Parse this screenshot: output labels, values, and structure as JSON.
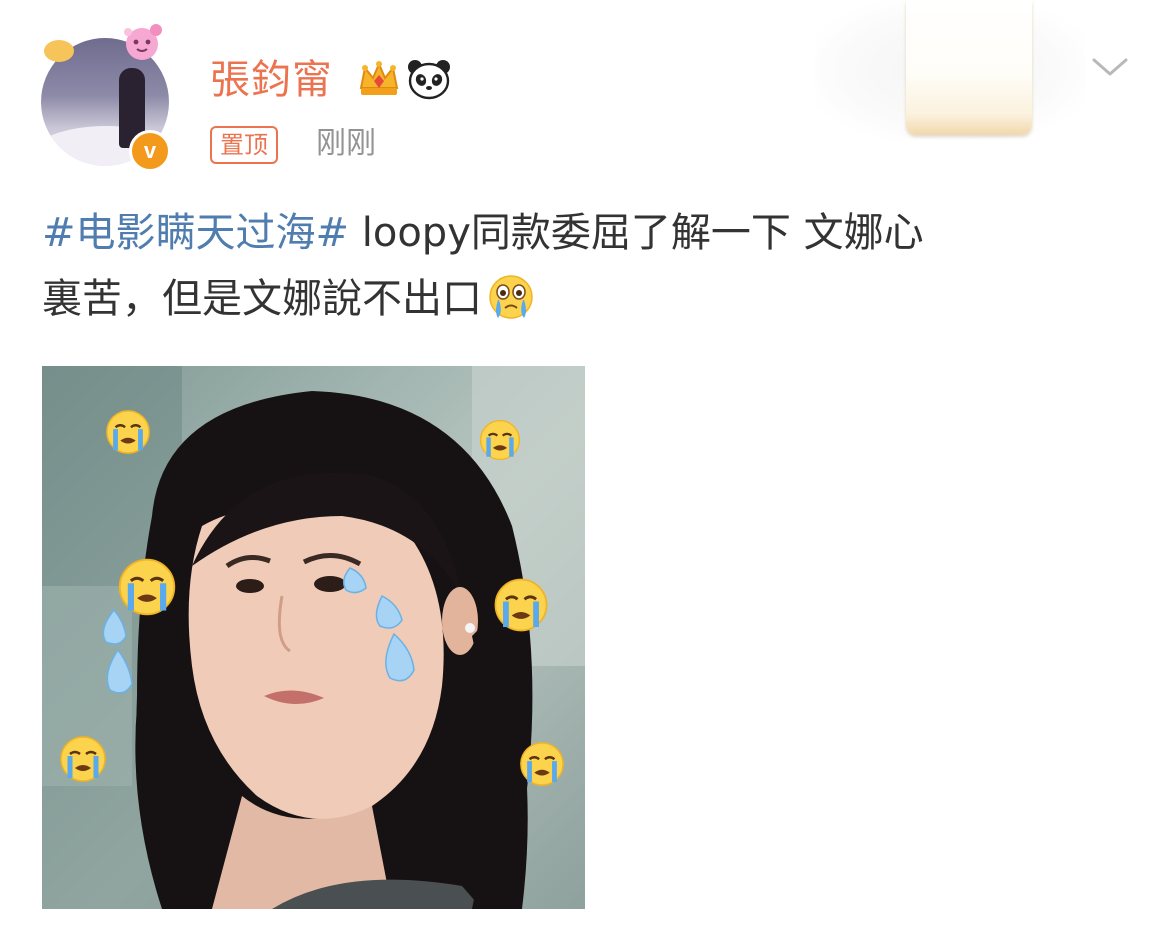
{
  "post": {
    "author": {
      "name": "張鈞甯",
      "avatar_icon": "avatar-photo",
      "verified_icon": "verified-v-icon",
      "verified_letter": "v",
      "badges": [
        "crown-icon",
        "panda-icon"
      ]
    },
    "pin_label": "置顶",
    "timestamp": "刚刚",
    "menu_icon": "chevron-down-icon",
    "text": {
      "hashtag": "#电影瞒天过海#",
      "line1_rest": " loopy同款委屈了解一下 文娜心",
      "line2": "裏苦，但是文娜說不出口",
      "emoji": "crying-face-emoji"
    },
    "image": {
      "subject": "woman-crying-meme",
      "stickers": [
        "crying-face-emoji",
        "teardrop"
      ]
    }
  },
  "colors": {
    "username": "#eb7350",
    "hashtag": "#507daf",
    "body_text": "#333333",
    "timestamp": "#939393",
    "verified": "#f39a1d"
  }
}
